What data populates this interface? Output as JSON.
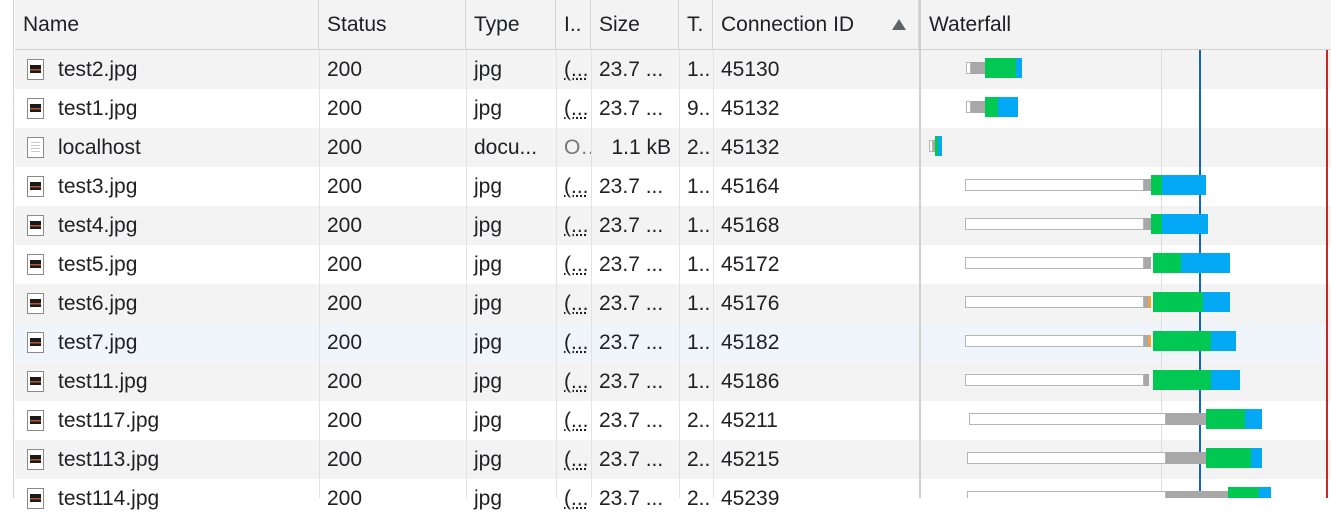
{
  "columns": {
    "name": "Name",
    "status": "Status",
    "type": "Type",
    "initiator": "I..",
    "size": "Size",
    "time": "T.",
    "connection": "Connection ID",
    "waterfall": "Waterfall"
  },
  "sort": {
    "column": "connection",
    "direction": "ascending"
  },
  "rows": [
    {
      "name": "test2.jpg",
      "status": "200",
      "type": "jpg",
      "initiator": "(...",
      "size": "23.7 ...",
      "time": "1..",
      "connection": "45130",
      "icon": "image-file-icon"
    },
    {
      "name": "test1.jpg",
      "status": "200",
      "type": "jpg",
      "initiator": "(...",
      "size": "23.7 ...",
      "time": "9..",
      "connection": "45132",
      "icon": "image-file-icon"
    },
    {
      "name": "localhost",
      "status": "200",
      "type": "docu...",
      "initiator": "O...",
      "size": "1.1 kB",
      "time": "2..",
      "connection": "45132",
      "icon": "document-file-icon"
    },
    {
      "name": "test3.jpg",
      "status": "200",
      "type": "jpg",
      "initiator": "(...",
      "size": "23.7 ...",
      "time": "1..",
      "connection": "45164",
      "icon": "image-file-icon"
    },
    {
      "name": "test4.jpg",
      "status": "200",
      "type": "jpg",
      "initiator": "(...",
      "size": "23.7 ...",
      "time": "1..",
      "connection": "45168",
      "icon": "image-file-icon"
    },
    {
      "name": "test5.jpg",
      "status": "200",
      "type": "jpg",
      "initiator": "(...",
      "size": "23.7 ...",
      "time": "1..",
      "connection": "45172",
      "icon": "image-file-icon"
    },
    {
      "name": "test6.jpg",
      "status": "200",
      "type": "jpg",
      "initiator": "(...",
      "size": "23.7 ...",
      "time": "1..",
      "connection": "45176",
      "icon": "image-file-icon"
    },
    {
      "name": "test7.jpg",
      "status": "200",
      "type": "jpg",
      "initiator": "(...",
      "size": "23.7 ...",
      "time": "1..",
      "connection": "45182",
      "icon": "image-file-icon"
    },
    {
      "name": "test11.jpg",
      "status": "200",
      "type": "jpg",
      "initiator": "(...",
      "size": "23.7 ...",
      "time": "1..",
      "connection": "45186",
      "icon": "image-file-icon"
    },
    {
      "name": "test117.jpg",
      "status": "200",
      "type": "jpg",
      "initiator": "(...",
      "size": "23.7 ...",
      "time": "2..",
      "connection": "45211",
      "icon": "image-file-icon"
    },
    {
      "name": "test113.jpg",
      "status": "200",
      "type": "jpg",
      "initiator": "(...",
      "size": "23.7 ...",
      "time": "2..",
      "connection": "45215",
      "icon": "image-file-icon"
    },
    {
      "name": "test114.jpg",
      "status": "200",
      "type": "jpg",
      "initiator": "(...",
      "size": "23.7 ...",
      "time": "2..",
      "connection": "45239",
      "icon": "image-file-icon"
    }
  ],
  "colors": {
    "waiting": "#00c853",
    "download": "#03a9f4",
    "stalled": "#a8a8a8",
    "dns": "#f1a33a",
    "dom_content_loaded": "#1565c0",
    "load": "#c62828"
  }
}
